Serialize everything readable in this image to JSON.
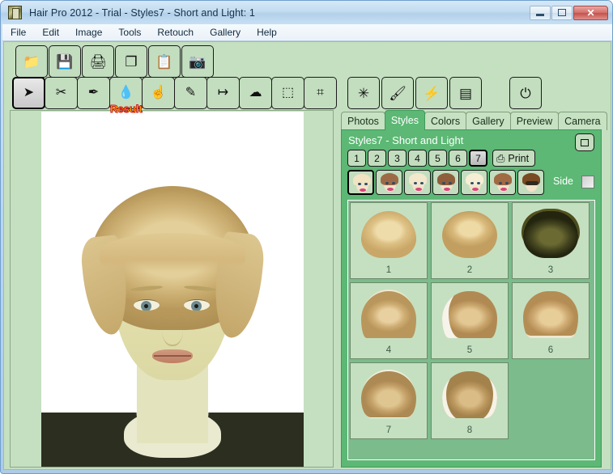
{
  "window": {
    "title": "Hair Pro 2012 - Trial - Styles7 - Short and Light: 1",
    "app_icon": "app-icon",
    "buttons": {
      "minimize": "minimize-icon",
      "maximize": "maximize-icon",
      "close": "✕"
    }
  },
  "menu": [
    {
      "label": "File",
      "accel": "F"
    },
    {
      "label": "Edit",
      "accel": "E"
    },
    {
      "label": "Image",
      "accel": "I"
    },
    {
      "label": "Tools",
      "accel": "T"
    },
    {
      "label": "Retouch",
      "accel": "R"
    },
    {
      "label": "Gallery",
      "accel": "G"
    },
    {
      "label": "Help",
      "accel": "H"
    }
  ],
  "toolbar_file": [
    {
      "name": "open-folder-icon",
      "glyph": "📁"
    },
    {
      "name": "save-disk-icon",
      "glyph": "💾"
    },
    {
      "name": "print-icon",
      "glyph": "🖨"
    },
    {
      "name": "copy-icon",
      "glyph": "❐"
    },
    {
      "name": "paste-icon",
      "glyph": "📋"
    },
    {
      "name": "camera-icon",
      "glyph": "📷"
    }
  ],
  "toolbar_tools": [
    {
      "name": "pointer-tool",
      "glyph": "➤",
      "selected": true
    },
    {
      "name": "scissors-tool",
      "glyph": "✂",
      "selected": false
    },
    {
      "name": "eyedropper-tool",
      "glyph": "✒",
      "selected": false
    },
    {
      "name": "waterdrop-tool",
      "glyph": "💧",
      "selected": false
    },
    {
      "name": "smudge-hand-tool",
      "glyph": "☝",
      "selected": false
    },
    {
      "name": "airbrush-tool",
      "glyph": "✎",
      "selected": false
    },
    {
      "name": "razor-tool",
      "glyph": "↦",
      "selected": false
    },
    {
      "name": "cloud-lasso-tool",
      "glyph": "☁",
      "selected": false
    },
    {
      "name": "rect-select-tool",
      "glyph": "⬚",
      "selected": false
    },
    {
      "name": "crop-tool",
      "glyph": "⌗",
      "selected": false
    }
  ],
  "toolbar_effects": [
    {
      "name": "magic-wand-tool",
      "glyph": "✳"
    },
    {
      "name": "paint-brush-tool",
      "glyph": "🖌"
    },
    {
      "name": "lightning-tool",
      "glyph": "⚡"
    },
    {
      "name": "cassette-tool",
      "glyph": "▤"
    }
  ],
  "toolbar_power": {
    "name": "power-button",
    "glyph": "⏻"
  },
  "canvas": {
    "overlay_label": "Result"
  },
  "tabs": [
    {
      "label": "Photos",
      "active": false
    },
    {
      "label": "Styles",
      "active": true
    },
    {
      "label": "Colors",
      "active": false
    },
    {
      "label": "Gallery",
      "active": false
    },
    {
      "label": "Preview",
      "active": false
    },
    {
      "label": "Camera",
      "active": false
    }
  ],
  "styles_panel": {
    "title": "Styles7 - Short and Light",
    "restore_button": "restore-window-button",
    "page_buttons": [
      {
        "label": "1",
        "selected": false
      },
      {
        "label": "2",
        "selected": false
      },
      {
        "label": "3",
        "selected": false
      },
      {
        "label": "4",
        "selected": false
      },
      {
        "label": "5",
        "selected": false
      },
      {
        "label": "6",
        "selected": false
      },
      {
        "label": "7",
        "selected": true
      }
    ],
    "print_label": "Print",
    "print_icon": "printer-icon",
    "face_presets": [
      {
        "name": "face-preset-1",
        "hair": "#f0e4c2",
        "selected": true,
        "glasses": false
      },
      {
        "name": "face-preset-2",
        "hair": "#9c6b46",
        "selected": false,
        "glasses": false
      },
      {
        "name": "face-preset-3",
        "hair": "#f2e8cc",
        "selected": false,
        "glasses": false
      },
      {
        "name": "face-preset-4",
        "hair": "#8f5f3c",
        "selected": false,
        "glasses": false
      },
      {
        "name": "face-preset-5",
        "hair": "#f6efd4",
        "selected": false,
        "glasses": false
      },
      {
        "name": "face-preset-6",
        "hair": "#a06a42",
        "selected": false,
        "glasses": false
      },
      {
        "name": "face-preset-7",
        "hair": "#7a4a22",
        "selected": false,
        "glasses": true
      }
    ],
    "side_label": "Side",
    "side_checked": false,
    "hairstyles": [
      {
        "caption": "1",
        "style": "h-bob",
        "name": "hairstyle-1"
      },
      {
        "caption": "2",
        "style": "h-fringe",
        "name": "hairstyle-2"
      },
      {
        "caption": "3",
        "style": "h-spiky",
        "name": "hairstyle-3"
      },
      {
        "caption": "4",
        "style": "h-updo-wisp",
        "name": "hairstyle-4"
      },
      {
        "caption": "5",
        "style": "h-updo-flower",
        "name": "hairstyle-5"
      },
      {
        "caption": "6",
        "style": "h-updo-tiara",
        "name": "hairstyle-6"
      },
      {
        "caption": "7",
        "style": "h-floral",
        "name": "hairstyle-7"
      },
      {
        "caption": "8",
        "style": "h-chignon",
        "name": "hairstyle-8"
      }
    ]
  },
  "colors": {
    "client_green": "#c5e0c1",
    "panel_green": "#5cb874",
    "grid_green": "#7bbb8c",
    "title_blue": "#c2dcf0",
    "accent_yellow": "#ffe800",
    "accent_red": "#d01010"
  }
}
